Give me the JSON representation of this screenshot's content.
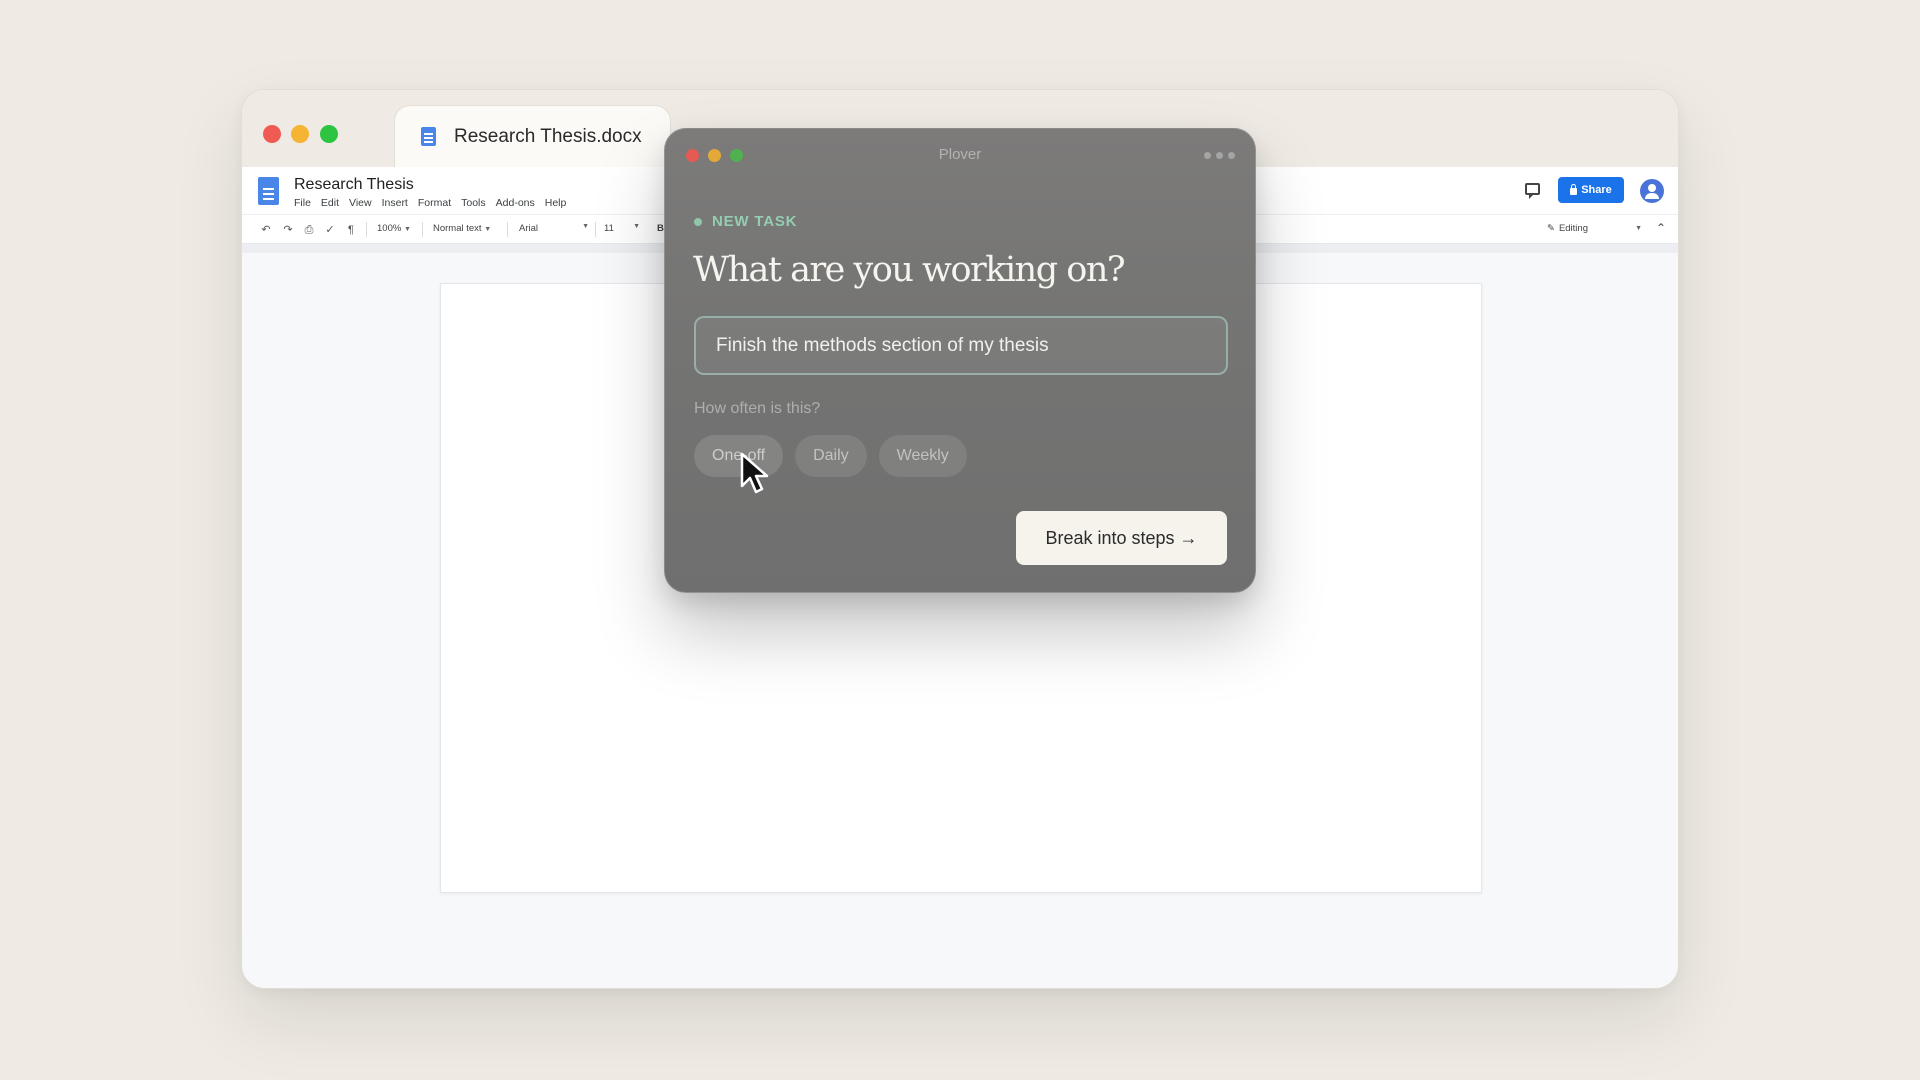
{
  "browser": {
    "tab_title": "Research Thesis.docx"
  },
  "docs": {
    "title": "Research Thesis",
    "menu": [
      "File",
      "Edit",
      "View",
      "Insert",
      "Format",
      "Tools",
      "Add-ons",
      "Help"
    ],
    "toolbar": {
      "zoom": "100%",
      "style": "Normal text",
      "font": "Arial",
      "size": "11",
      "bold": "B",
      "mode": "Editing"
    },
    "share_label": "Share"
  },
  "plover": {
    "window_title": "Plover",
    "status_label": "NEW TASK",
    "headline": "What are you working on?",
    "task_input_value": "Finish the methods section of my thesis",
    "frequency_question": "How often is this?",
    "frequency_options": [
      "One-off",
      "Daily",
      "Weekly"
    ],
    "selected_frequency": "One-off",
    "cta_label": "Break into steps →"
  },
  "colors": {
    "background": "#efebe4",
    "share_blue": "#1a73e8",
    "status_green": "#95cdb0",
    "cta_bg": "#f6f3ec"
  },
  "icons": [
    "doc-icon",
    "comment-icon",
    "lock-icon",
    "avatar",
    "undo-icon",
    "redo-icon",
    "print-icon",
    "spellcheck-icon",
    "paint-format-icon",
    "pencil-icon",
    "collapse-icon",
    "more-icon",
    "cursor-pointer-icon"
  ]
}
